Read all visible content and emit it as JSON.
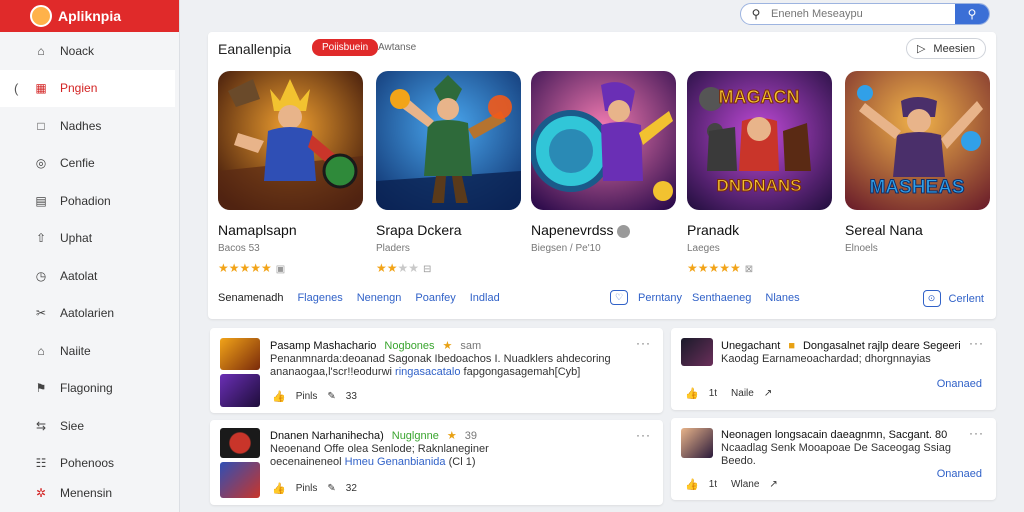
{
  "app": {
    "title": "Apliknpia"
  },
  "sidebar": {
    "items": [
      {
        "label": "Noack",
        "icon": "home-icon",
        "glyph": "⌂"
      },
      {
        "label": "Pngien",
        "icon": "grid-icon",
        "glyph": "▦"
      },
      {
        "label": "Nadhes",
        "icon": "square-icon",
        "glyph": "□"
      },
      {
        "label": "Cenfie",
        "icon": "circle-icon",
        "glyph": "◎"
      },
      {
        "label": "Pohadion",
        "icon": "layout-icon",
        "glyph": "▤"
      },
      {
        "label": "Uphat",
        "icon": "upload-icon",
        "glyph": "⇧"
      },
      {
        "label": "Aatolat",
        "icon": "clock-icon",
        "glyph": "◷"
      },
      {
        "label": "Aatolarien",
        "icon": "tools-icon",
        "glyph": "✂"
      },
      {
        "label": "Naiite",
        "icon": "house-icon",
        "glyph": "⌂"
      },
      {
        "label": "Flagoning",
        "icon": "flag-icon",
        "glyph": "⚑"
      },
      {
        "label": "Siee",
        "icon": "share-icon",
        "glyph": "⇆"
      },
      {
        "label": "Pohenoos",
        "icon": "users-icon",
        "glyph": "☷"
      },
      {
        "label": "Menensin",
        "icon": "gear-icon",
        "glyph": "✲"
      }
    ]
  },
  "search": {
    "placeholder": "Eneneh Meseaypu"
  },
  "featured": {
    "title": "Eanallenpia",
    "pill": "Poiisbuein",
    "tag": "Awtanse",
    "button": "Meesien",
    "cards": [
      {
        "name": "Namaplsapn",
        "sub": "Bacos 53",
        "stars": 5,
        "thumb": {
          "bg1": "#d56a1c",
          "bg2": "#4a1d0c",
          "hero": "#2f4fb5",
          "accent": "#f2c230"
        }
      },
      {
        "name": "Srapa Dckera",
        "sub": "Pladers",
        "stars": 2,
        "thumb": {
          "bg1": "#1e78d6",
          "bg2": "#0d2e6a",
          "hero": "#2e6a3a",
          "accent": "#f2a419"
        }
      },
      {
        "name": "Napenevrdss",
        "sub": "Biegsen / Pe'10",
        "stars": 0,
        "thumb": {
          "bg1": "#e04a82",
          "bg2": "#3a0d5c",
          "hero": "#6a2fb5",
          "accent": "#31c6d8"
        }
      },
      {
        "name": "Pranadk",
        "sub": "Laeges",
        "stars": 5,
        "thumb": {
          "bg1": "#7a2fb5",
          "bg2": "#1e0d3a",
          "hero": "#c9352a",
          "accent": "#f2c230"
        },
        "logo_top": "MAGACN",
        "logo_bottom": "DNDNANS"
      },
      {
        "name": "Sereal Nana",
        "sub": "Elnoels",
        "stars": 0,
        "thumb": {
          "bg1": "#f28a1c",
          "bg2": "#6a1d2a",
          "hero": "#4a2f6a",
          "accent": "#31a0e8"
        },
        "logo_bottom": "MASHEAS"
      }
    ],
    "links": [
      "Senamenadh",
      "Flagenes",
      "Nenengn",
      "Poanfey",
      "Indlad"
    ],
    "links_mid": [
      "Perntany",
      "Senthaeneg",
      "Nlanes"
    ],
    "links_right": "Cerlent"
  },
  "posts": [
    {
      "title": "Pasamp Mashachario",
      "tag": "Nogbones",
      "time": "sam",
      "line1": "Penanmnarda:deoanad Sagonak Ibedoachos I. Nuadklers ahdecoring",
      "line2a": "ananaogaa,l'scr!!eodurwi",
      "line2b": "ringasacatalo",
      "line2c": "fapgongasagemah[Cyb]",
      "likes": "Pinls",
      "comments": "33"
    },
    {
      "title": "Unegachant",
      "tag": "",
      "time": "",
      "line1": "Dongasalnet rajlp deare Segeeri",
      "line2a": "Kaodag Earnameoachardad; dhorgnnayias",
      "line2b": "",
      "line2c": "",
      "likes": "Naile",
      "comments": "",
      "count": "1t",
      "action": "Onanaed"
    },
    {
      "title": "Dnanen Narhanihecha)",
      "tag": "Nuglgnne",
      "time": "39",
      "line1": "Neoenand Offe olea Senlode; Raknlaneginer",
      "line2a": "oecenaineneol",
      "line2b": "Hmeu Genanbianida",
      "line2c": "(Cl 1)",
      "likes": "Pinls",
      "comments": "32"
    },
    {
      "title": "Neonagen longsacain daeagnmn, Sacgant. 80",
      "tag": "",
      "time": "",
      "line1": "Ncaadlag Senk Mooapoae De Saceogag Ssiag",
      "line2a": "Beedo.",
      "line2b": "",
      "line2c": "",
      "likes": "Wlane",
      "comments": "",
      "count": "1t",
      "action": "Onanaed"
    }
  ],
  "colors": {
    "brand": "#e02a2a",
    "accent": "#3162c8",
    "star": "#f2a419",
    "tag_green": "#3aa52f"
  }
}
